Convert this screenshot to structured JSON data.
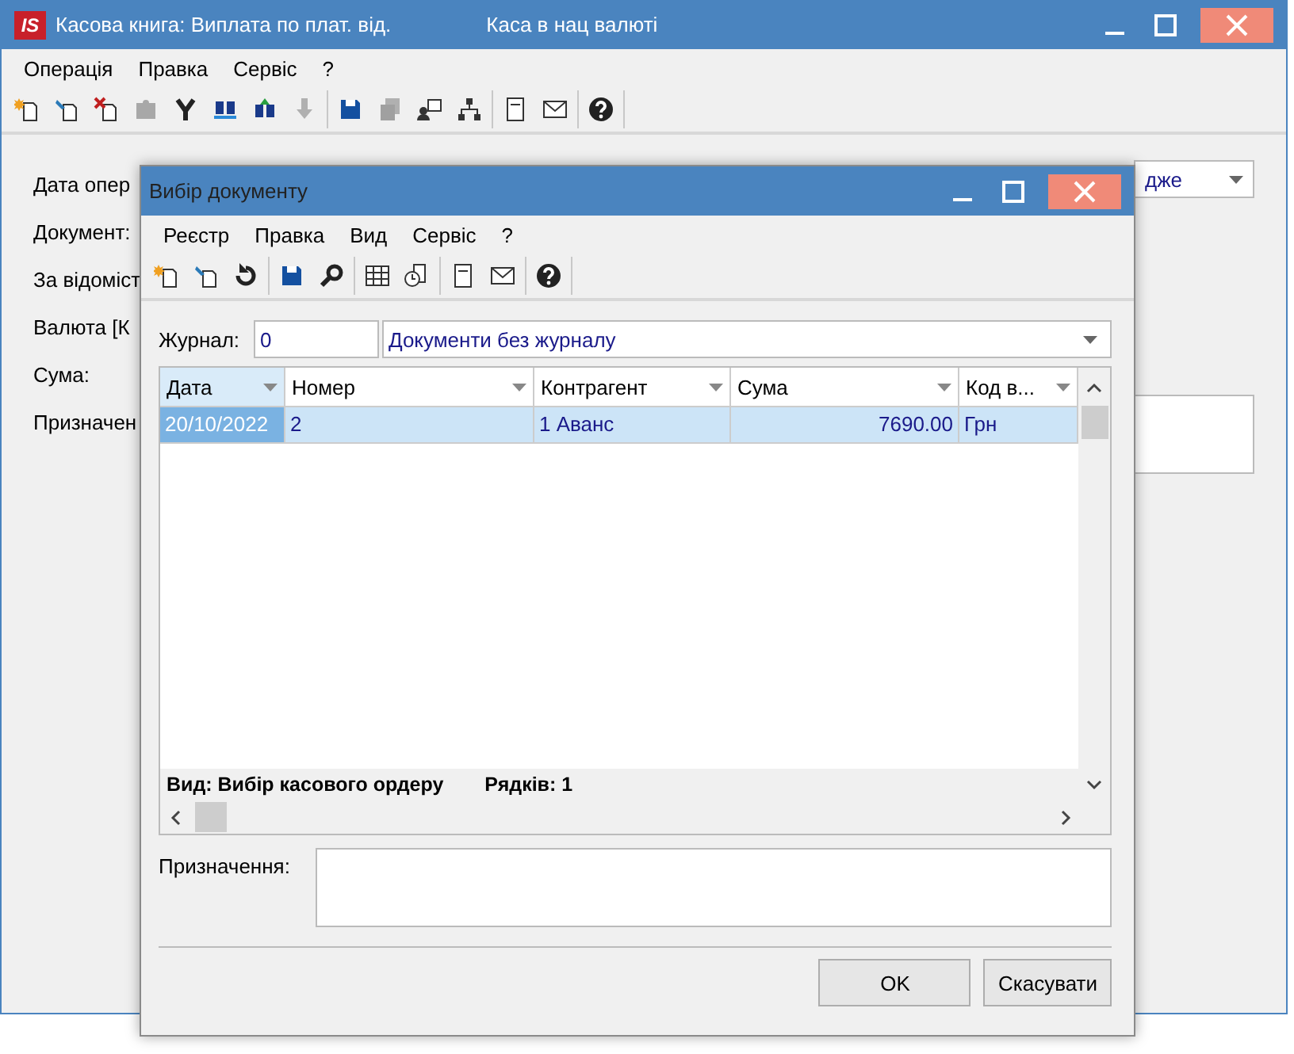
{
  "main_window": {
    "logo": "IS",
    "title": "Касова книга: Виплата по плат. від.",
    "subtitle": "Каса в нац валюті",
    "menu": [
      "Операція",
      "Правка",
      "Сервіс",
      "?"
    ],
    "form_labels": [
      "Дата опер",
      "Документ:",
      "За відоміст",
      "Валюта [К",
      "Сума:",
      "Призначен"
    ],
    "dropdown_value": "дже"
  },
  "dialog": {
    "title": "Вибір документу",
    "menu": [
      "Реєстр",
      "Правка",
      "Вид",
      "Сервіс",
      "?"
    ],
    "journal": {
      "label": "Журнал:",
      "code": "0",
      "name": "Документи без журналу"
    },
    "table": {
      "columns": [
        {
          "label": "Дата",
          "sorted": true
        },
        {
          "label": "Номер",
          "sorted": false
        },
        {
          "label": "Контрагент",
          "sorted": false
        },
        {
          "label": "Сума",
          "sorted": false
        },
        {
          "label": "Код в...",
          "sorted": false
        }
      ],
      "rows": [
        {
          "cells": [
            "20/10/2022",
            "2",
            "1 Аванс",
            "7690.00",
            "Грн"
          ],
          "selected": true
        }
      ],
      "status": [
        "Вид: Вибір касового ордеру",
        "Рядків: 1"
      ]
    },
    "purpose_label": "Призначення:",
    "buttons": [
      "OK",
      "Скасувати"
    ]
  }
}
